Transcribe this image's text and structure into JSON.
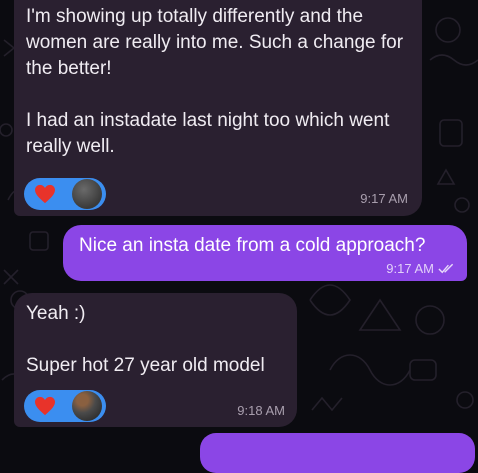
{
  "colors": {
    "background": "#0b0b10",
    "incoming_bubble": "#2a2030",
    "outgoing_bubble": "#8b46e6",
    "reaction_pill": "#3b8ef0",
    "heart": "#e8332a"
  },
  "messages": [
    {
      "direction": "incoming",
      "text": "I'm showing up totally differently and the women are really into me. Such a change for the better!\n\nI had an instadate last night too which went really well.",
      "time": "9:17 AM",
      "reaction": {
        "icon": "heart-icon",
        "reactor": "avatar"
      }
    },
    {
      "direction": "outgoing",
      "text": "Nice an insta date from a cold approach?",
      "time": "9:17 AM",
      "status_icon": "double-check-icon"
    },
    {
      "direction": "incoming",
      "text": "Yeah :)\n\nSuper hot 27 year old model",
      "time": "9:18 AM",
      "reaction": {
        "icon": "heart-icon",
        "reactor": "avatar"
      }
    },
    {
      "direction": "outgoing",
      "text": ""
    }
  ]
}
